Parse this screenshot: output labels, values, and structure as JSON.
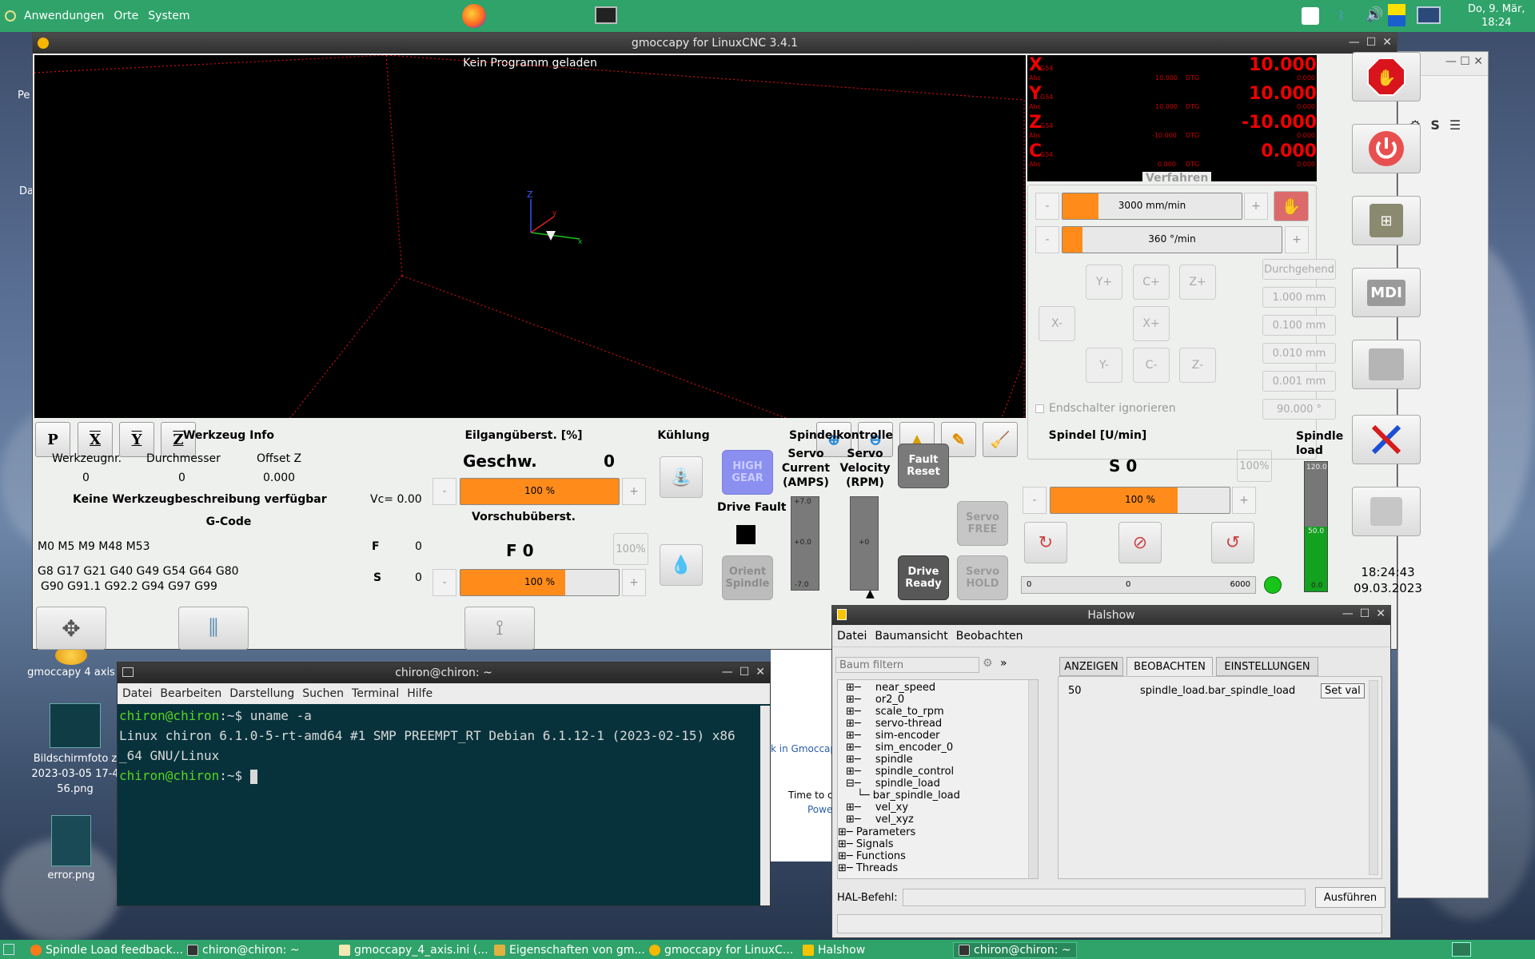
{
  "top_panel": {
    "menu": [
      "Anwendungen",
      "Orte",
      "System"
    ],
    "clock_date": "Do, 9. Mär,",
    "clock_time": "18:24"
  },
  "desktop": {
    "icons": [
      {
        "label": "gmoccapy 4 axis"
      },
      {
        "label": "Bildschirmfoto z 2023-03-05 17-4 56.png"
      },
      {
        "label": "error.png"
      }
    ],
    "side_labels": [
      "Pe",
      "Da"
    ]
  },
  "gmoccapy": {
    "title": "gmoccapy for LinuxCNC 3.4.1",
    "preview_text": "Kein Programm geladen",
    "view_buttons": [
      "P",
      "X",
      "Y",
      "Z"
    ],
    "dro": [
      {
        "axis": "X",
        "value": "10.000",
        "rel": "10.000",
        "dtg": "0.000"
      },
      {
        "axis": "Y",
        "value": "10.000",
        "rel": "10.000",
        "dtg": "0.000"
      },
      {
        "axis": "Z",
        "value": "-10.000",
        "rel": "-10.000",
        "dtg": "0.000"
      },
      {
        "axis": "C",
        "value": "0.000",
        "rel": "0.000",
        "dtg": "0.000"
      }
    ],
    "dro_labels": {
      "g54": "G54",
      "abs": "Abs",
      "dtg": "DTG"
    },
    "verfahren": {
      "title": "Verfahren",
      "linear_speed": "3000 mm/min",
      "linear_fill": 0.2,
      "angular_speed": "360 °/min",
      "angular_fill": 0.09,
      "jog_buttons": [
        "Y+",
        "C+",
        "Z+",
        "X-",
        "X+",
        "Y-",
        "C-",
        "Z-"
      ],
      "increments": [
        "Durchgehend",
        "1.000 mm",
        "0.100 mm",
        "0.010 mm",
        "0.001 mm",
        "90.000 °"
      ],
      "ignore_limits": "Endschalter ignorieren"
    },
    "werkzeug": {
      "title": "Werkzeug Info",
      "headers": [
        "Werkzeugnr.",
        "Durchmesser",
        "Offset Z"
      ],
      "values": [
        "0",
        "0",
        "0.000"
      ],
      "description": "Keine Werkzeugbeschreibung verfügbar",
      "vc": "Vc= 0.00"
    },
    "gcode": {
      "title": "G-Code",
      "mcodes": "M0 M5 M9 M48 M53",
      "gcodes_1": "G8 G17 G21 G40 G49 G54 G64 G80",
      "gcodes_2": "G90 G91.1 G92.2 G94 G97 G99",
      "f_label": "F",
      "f_value": "0",
      "s_label": "S",
      "s_value": "0"
    },
    "eilgang": {
      "title": "Eilgangüberst. [%]",
      "label": "Geschw.",
      "value": "0",
      "bar": "100 %",
      "fill": 1.0
    },
    "vorschub": {
      "title": "Vorschubüberst.",
      "label": "F 0",
      "pct": "100%",
      "bar": "100 %",
      "fill": 0.66
    },
    "kuehlung": {
      "title": "Kühlung"
    },
    "spindelkontrolle": {
      "title": "Spindelkontrolle",
      "high_gear": "HIGH GEAR",
      "servo_current": "Servo Current (AMPS)",
      "servo_velocity": "Servo Velocity (RPM)",
      "fault_reset": "Fault Reset",
      "drive_fault": "Drive Fault",
      "orient_spindle": "Orient Spindle",
      "servo_free": "Servo FREE",
      "drive_ready": "Drive Ready",
      "servo_hold": "Servo HOLD",
      "current_scale": [
        "+7.0",
        "+0.0",
        "-7.0"
      ],
      "velocity_scale": "+0"
    },
    "spindel": {
      "title": "Spindel [U/min]",
      "value": "S 0",
      "pct": "100%",
      "bar": "100 %",
      "fill": 0.71,
      "scale_min": "0",
      "scale_mid": "0",
      "scale_max": "6000"
    },
    "spindle_load": {
      "title": "Spindle load",
      "scale": [
        "120.0",
        "50.0",
        "0.0"
      ],
      "level": 0.5
    },
    "clock_time": "18:24:43",
    "clock_date": "09.03.2023",
    "side_buttons": [
      "estop",
      "power",
      "manual",
      "MDI",
      "auto",
      "settings",
      "user"
    ]
  },
  "terminal": {
    "title": "chiron@chiron: ~",
    "menu": [
      "Datei",
      "Bearbeiten",
      "Darstellung",
      "Suchen",
      "Terminal",
      "Hilfe"
    ],
    "prompt": "chiron@chiron",
    "path": ":~$ ",
    "command": "uname -a",
    "output_1": "Linux chiron 6.1.0-5-rt-amd64 #1 SMP PREEMPT_RT Debian 6.1.12-1 (2023-02-15) x86",
    "output_2": "_64 GNU/Linux"
  },
  "halshow": {
    "title": "Halshow",
    "menu": [
      "Datei",
      "Baumansicht",
      "Beobachten"
    ],
    "filter_placeholder": "Baum filtern",
    "tabs": [
      "ANZEIGEN",
      "BEOBACHTEN",
      "EINSTELLUNGEN"
    ],
    "tree": [
      "near_speed",
      "or2_0",
      "scale_to_rpm",
      "servo-thread",
      "sim-encoder",
      "sim_encoder_0",
      "spindle",
      "spindle_control",
      "spindle_load",
      "bar_spindle_load",
      "vel_xy",
      "vel_xyz",
      "Parameters",
      "Signals",
      "Functions",
      "Threads"
    ],
    "watch_value": "50",
    "watch_pin": "spindle_load.bar_spindle_load",
    "set_val": "Set val",
    "hal_command_label": "HAL-Befehl:",
    "execute": "Ausführen"
  },
  "background_window": {
    "text_1": "k in Gmoccap",
    "text_2": "Time to c",
    "text_3": "Powe"
  },
  "taskbar": {
    "items": [
      "Spindle Load feedback...",
      "chiron@chiron: ~",
      "gmoccapy_4_axis.ini (...",
      "Eigenschaften von gm...",
      "gmoccapy for LinuxC...",
      "Halshow",
      "chiron@chiron: ~"
    ]
  }
}
